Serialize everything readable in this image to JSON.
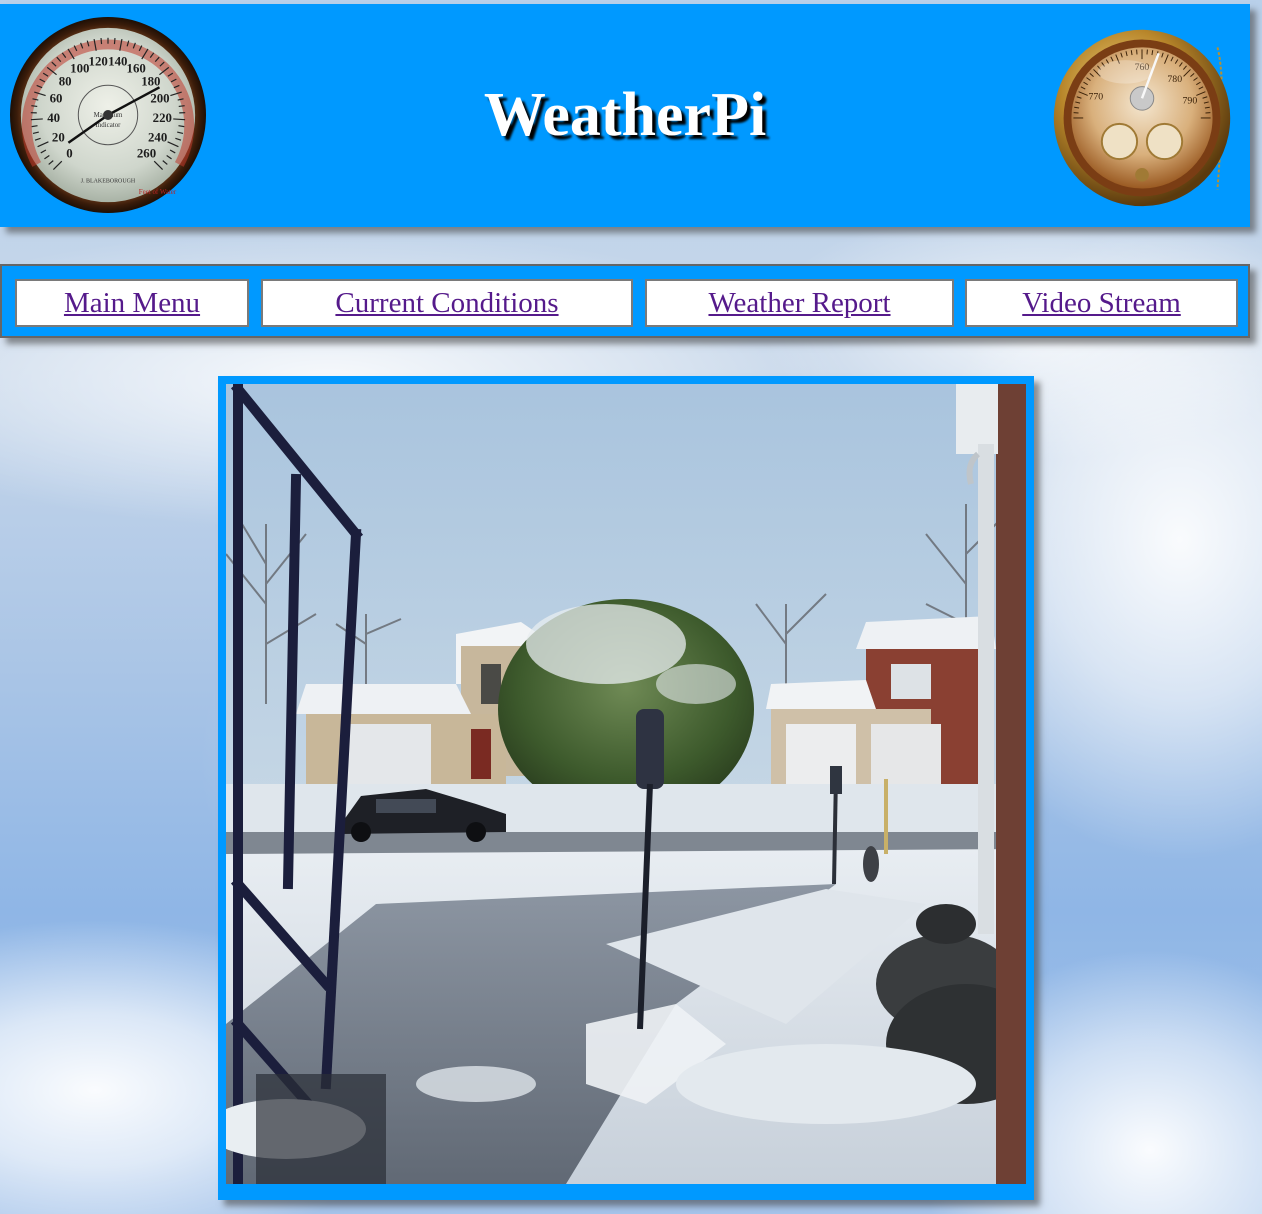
{
  "site": {
    "title": "WeatherPi"
  },
  "header": {
    "left_image": "thermometer-gauge-icon",
    "right_image": "barometer-gauge-icon",
    "left_gauge_numbers": [
      "0",
      "20",
      "40",
      "60",
      "80",
      "100",
      "120",
      "140",
      "160",
      "180",
      "200",
      "220",
      "240",
      "260"
    ],
    "right_gauge_numbers": [
      "760",
      "770",
      "780",
      "790"
    ]
  },
  "nav": {
    "items": [
      {
        "label": "Main Menu"
      },
      {
        "label": "Current Conditions"
      },
      {
        "label": "Weather Report"
      },
      {
        "label": "Video Stream"
      }
    ]
  },
  "camera": {
    "image": "snowy-street-camera-image"
  },
  "colors": {
    "header_bg": "#0099ff",
    "nav_bg": "#0099ff",
    "link": "#551a8b",
    "title_text": "#ffffff",
    "title_shadow": "#000000"
  }
}
